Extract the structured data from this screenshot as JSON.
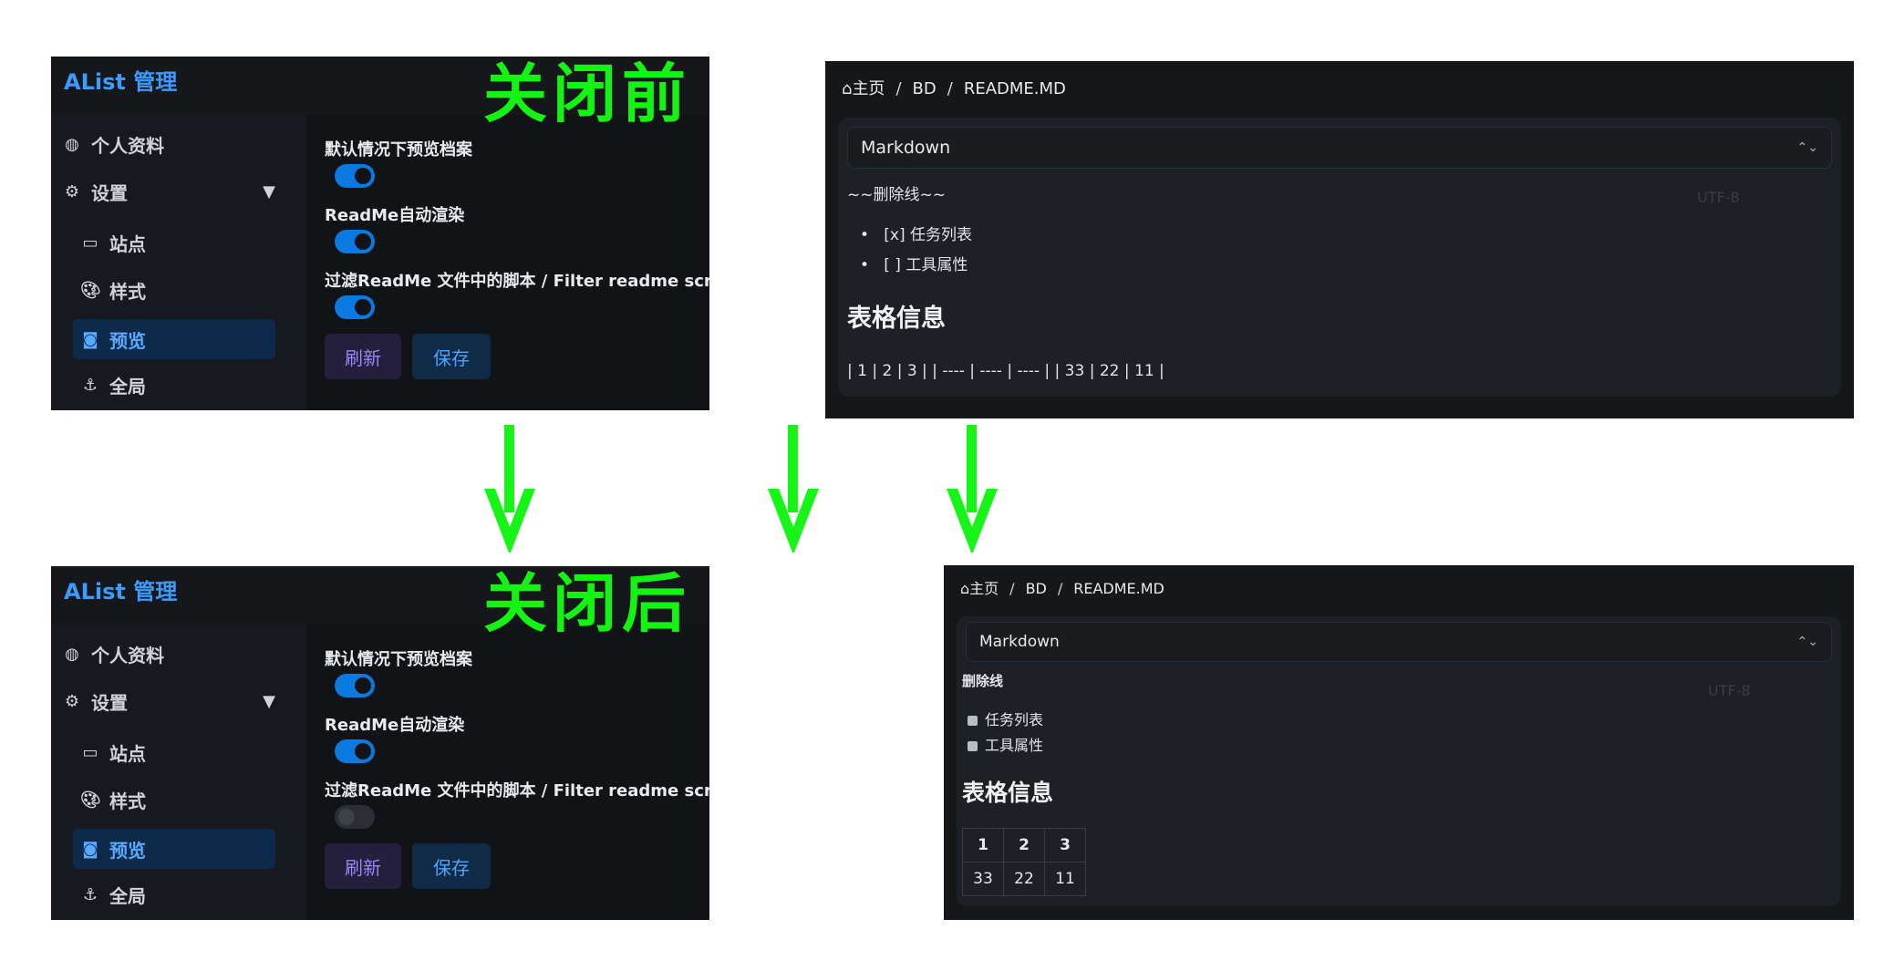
{
  "admin": {
    "title": "AList 管理",
    "sidebar": {
      "profile": "个人资料",
      "settings": "设置",
      "site": "站点",
      "style": "样式",
      "preview": "预览",
      "global": "全局"
    },
    "options": {
      "default_preview": "默认情况下预览档案",
      "readme_render": "ReadMe自动渲染",
      "filter_scripts": "过滤ReadMe 文件中的脚本 / Filter readme scripts"
    },
    "buttons": {
      "refresh": "刷新",
      "save": "保存"
    }
  },
  "stamps": {
    "before": "关闭前",
    "after": "关闭后"
  },
  "before_state": {
    "filter_scripts_on": true
  },
  "after_state": {
    "filter_scripts_on": false
  },
  "viewer": {
    "breadcrumb": {
      "home": "主页",
      "folder": "BD",
      "file": "README.MD",
      "separator": "/"
    },
    "select": {
      "value": "Markdown",
      "encoding": "UTF-8"
    },
    "before": {
      "strike_raw": "~~删除线~~",
      "list_items": [
        "[x] 任务列表",
        "[ ] 工具属性"
      ],
      "heading": "表格信息",
      "table_raw": "| 1 | 2 | 3 | | ---- | ---- | ---- | | 33 | 22 | 11 |"
    },
    "after": {
      "strike": "删除线",
      "task_items": [
        "任务列表",
        "工具属性"
      ],
      "heading": "表格信息",
      "table": [
        [
          "1",
          "2",
          "3"
        ],
        [
          "33",
          "22",
          "11"
        ]
      ]
    }
  },
  "colors": {
    "arrow": "#17f417",
    "accent": "#3b9cff",
    "toggle_on": "#0a7ae0"
  }
}
